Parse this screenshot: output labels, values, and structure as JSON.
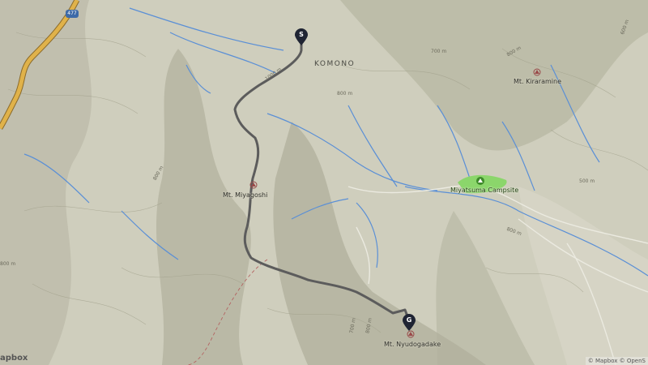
{
  "map": {
    "road_shield": "477",
    "place_label": "KOMONO",
    "peaks": [
      {
        "name": "Mt. Miyagoshi"
      },
      {
        "name": "Mt. Kiraramine"
      },
      {
        "name": "Mt. Nyudogadake"
      }
    ],
    "campsite": "Miyatsuma Campsite",
    "elevation_labels": [
      "1000 m",
      "800 m",
      "800 m",
      "700 m",
      "800 m",
      "600 m",
      "500 m",
      "700 m",
      "800 m",
      "800 m",
      "800 m"
    ],
    "start_marker": "S",
    "end_marker": "G",
    "attribution": "© Mapbox © OpenS",
    "logo": "apbox",
    "colors": {
      "terrain": "#c9c8b6",
      "route": "#5c5c5c",
      "water": "#5a8fd6",
      "highway": "#e0b24a",
      "campsite_fill": "#8bd66b"
    }
  }
}
